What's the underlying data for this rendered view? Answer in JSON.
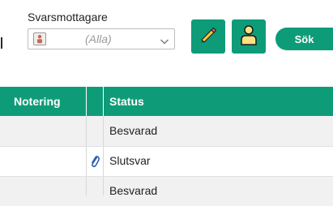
{
  "filter": {
    "label": "Svarsmottagare",
    "selected_value": "(Alla)",
    "avatar_icon": "recipient-avatar-icon",
    "dropdown_icon": "chevron-down-icon"
  },
  "toolbar": {
    "edit_icon": "pencil-icon",
    "person_icon": "person-icon",
    "search_label": "Sök"
  },
  "table": {
    "columns": [
      "Notering",
      "",
      "Status"
    ],
    "rows": [
      {
        "notering": "",
        "attachment": false,
        "status": "Besvarad"
      },
      {
        "notering": "",
        "attachment": true,
        "status": "Slutsvar"
      },
      {
        "notering": "",
        "attachment": false,
        "status": "Besvarad"
      }
    ]
  },
  "colors": {
    "accent": "#0e9c78",
    "row_shade": "#f1f1f1",
    "attachment": "#2f5fb5"
  }
}
